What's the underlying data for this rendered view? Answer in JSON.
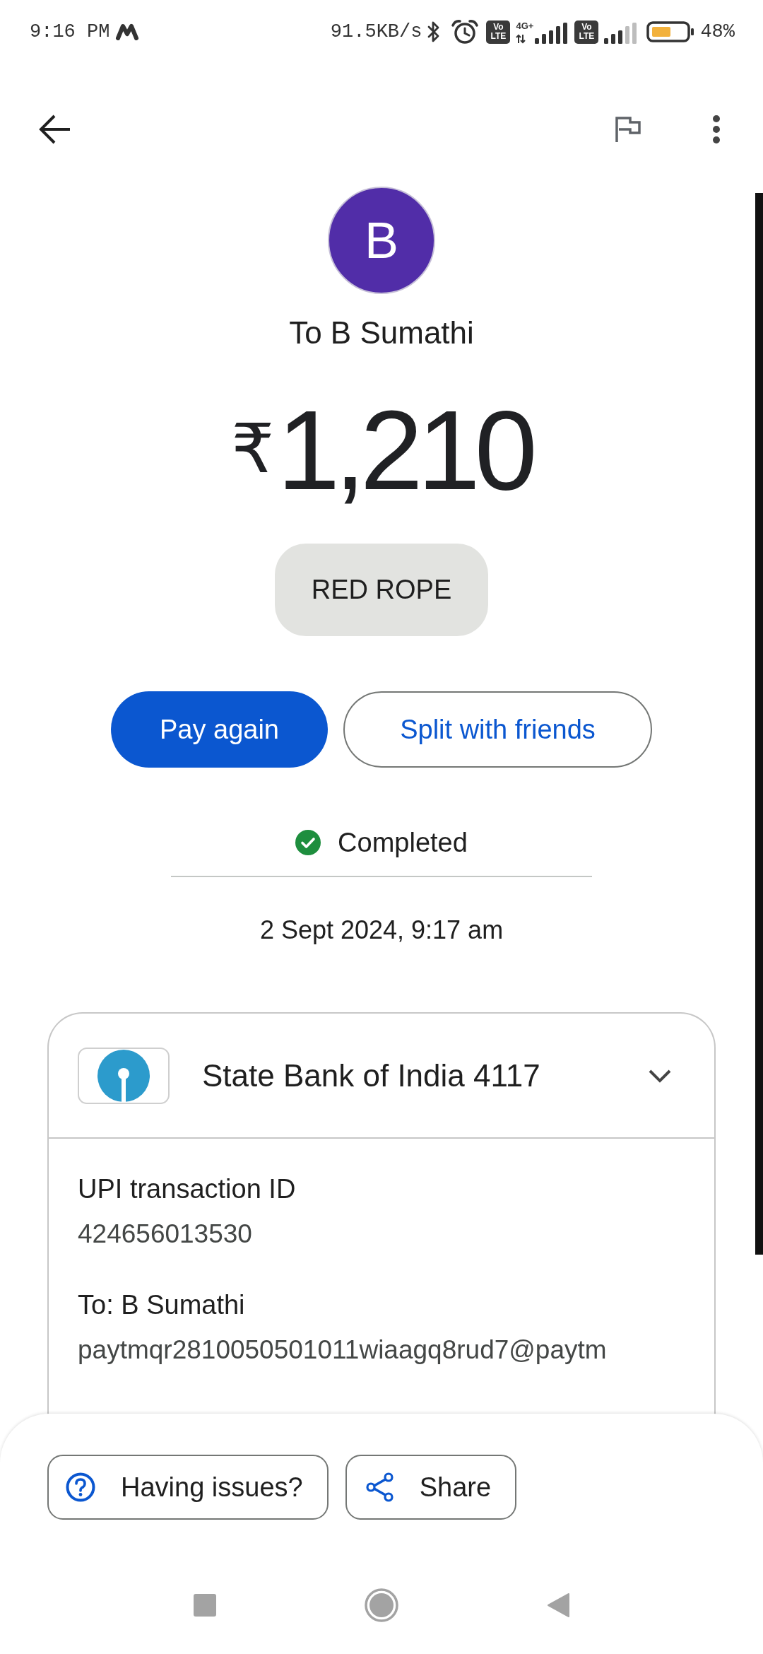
{
  "status_bar": {
    "time": "9:16 PM",
    "net_speed": "91.5KB/s",
    "sims": [
      {
        "badge": "Vo LTE",
        "network": "4G+"
      },
      {
        "badge": "Vo LTE"
      }
    ],
    "battery": "48%"
  },
  "recipient": {
    "initial": "B",
    "label": "To B Sumathi"
  },
  "amount": "$^{₹}$1,210",
  "note": "RED ROPE",
  "actions": [
    {
      "kind": "filled",
      "label": "Pay again"
    },
    {
      "kind": "outlined",
      "label": "Split with friends"
    }
  ],
  "status": {
    "kind": "completed",
    "label": "Completed"
  },
  "timestamp": "2 Sept 2024, 9:17 am",
  "account": {
    "bank": "State Bank of India 4117",
    "details": [
      {
        "label": "UPI transaction ID",
        "value": "424656013530"
      },
      {
        "label": "To: B Sumathi",
        "value": "paytmqr2810050501011wiaagq8rud7@paytm"
      }
    ]
  },
  "bottom_actions": [
    {
      "kind": "help",
      "label": "Having issues?"
    },
    {
      "kind": "share",
      "label": "Share"
    }
  ]
}
